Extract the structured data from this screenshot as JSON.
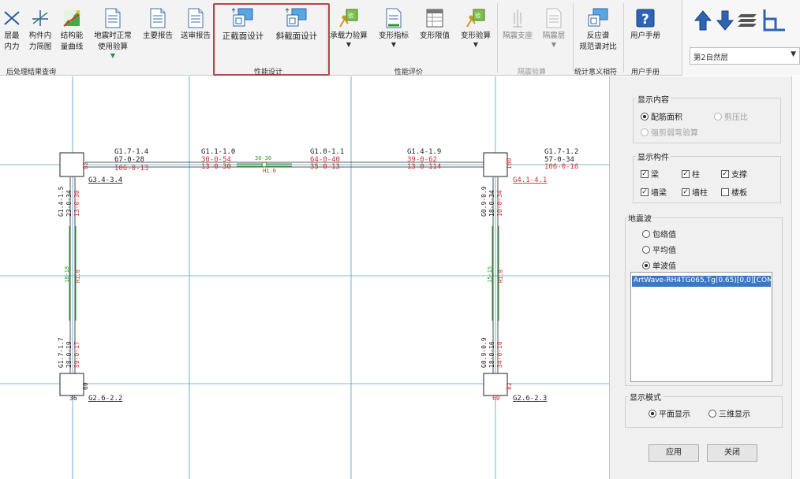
{
  "ribbon": {
    "tools": [
      {
        "id": "force",
        "line1": "层最",
        "line2": "内力",
        "icon": "force-icon"
      },
      {
        "id": "member-internal",
        "line1": "构件内",
        "line2": "力简图",
        "icon": "member-force-icon"
      },
      {
        "id": "struct-perf",
        "line1": "结构能",
        "line2": "量曲线",
        "icon": "energy-curve-icon"
      },
      {
        "id": "seismic-normal",
        "line1": "地震时正常",
        "line2": "使用验算",
        "icon": "document-icon"
      },
      {
        "id": "main-report",
        "line1": "主要报告",
        "line2": "",
        "icon": "document-icon"
      },
      {
        "id": "review-report",
        "line1": "送审报告",
        "line2": "",
        "icon": "document-icon"
      },
      {
        "id": "normal-section",
        "line1": "正截面设计",
        "line2": "",
        "icon": "section-design-icon"
      },
      {
        "id": "oblique-section",
        "line1": "斜截面设计",
        "line2": "",
        "icon": "section-design-icon"
      },
      {
        "id": "bearing-check",
        "line1": "承载力验算",
        "line2": "",
        "icon": "check-icon"
      },
      {
        "id": "deform-index",
        "line1": "变形指标",
        "line2": "",
        "icon": "document-icon"
      },
      {
        "id": "deform-limit",
        "line1": "变形限值",
        "line2": "",
        "icon": "table-icon"
      },
      {
        "id": "deform-check",
        "line1": "变形验算",
        "line2": "",
        "icon": "check-icon"
      },
      {
        "id": "isolation-support",
        "line1": "隔震支座",
        "line2": "",
        "icon": "support-icon"
      },
      {
        "id": "isolation-layer",
        "line1": "隔震层",
        "line2": "",
        "icon": "document-icon"
      },
      {
        "id": "response-spectrum",
        "line1": "反应谱",
        "line2": "规范谱对比",
        "icon": "spectrum-icon"
      },
      {
        "id": "user-manual",
        "line1": "用户手册",
        "line2": "",
        "icon": "help-icon"
      }
    ],
    "groups": {
      "postprocess": "后处理结果查询",
      "performance_design": "性能设计",
      "performance_eval": "性能评价",
      "isolation_check": "隔震验算",
      "statistics": "统计意义相符",
      "manual": "用户手册"
    },
    "floor_selector": "第2自然层"
  },
  "canvas": {
    "labels": {
      "beam1": [
        "G1.7-1.4",
        "67-0-28",
        "106-0-13"
      ],
      "beam2": [
        "G1.1-1.0",
        "30-0-54",
        "13-0-30"
      ],
      "beam3": [
        "G1.0-1.1",
        "64-0-40",
        "35-0-13"
      ],
      "beam4": [
        "G1.4-1.9",
        "39-0-62",
        "13-0-114"
      ],
      "beam5": [
        "G1.7-1.2",
        "57-0-34",
        "106-0-16"
      ],
      "coupling_top": "30-30",
      "coupling_bot": "H1.0",
      "col_tl": "G3.4-3.4",
      "col_tr": "G4.1-4.1",
      "col_bl": "G2.6-2.2",
      "col_br": "G2.6-2.3",
      "col_tl_num": "82",
      "col_tr_num": "100",
      "col_bl_num": "60",
      "col_bl_num2": "36",
      "col_br_num": "82",
      "col_br_num2": "60",
      "vbeam_l_top": [
        "G1.4-1.5",
        "23-0-34",
        "13-0-30"
      ],
      "vbeam_r_top": [
        "G0.9-0.9",
        "18-0-34",
        "10-0-34"
      ],
      "vbeam_l_bot": [
        "G1.7-1.7",
        "28-0-19",
        "59-0-17"
      ],
      "vbeam_r_bot": [
        "G0.9-0.9",
        "18-0-16",
        "34-0-10"
      ],
      "wall_l": [
        "18-18",
        "H1.0"
      ],
      "wall_r": [
        "15-15",
        "H1.0"
      ]
    }
  },
  "panel": {
    "display_content": {
      "title": "显示内容",
      "rebar_area": "配筋面积",
      "shear_ratio": "剪压比",
      "strong_shear": "强剪弱弯验算"
    },
    "display_members": {
      "title": "显示构件",
      "beam": "梁",
      "column": "柱",
      "brace": "支撑",
      "wall_beam": "墙梁",
      "wall_column": "墙柱",
      "slab": "楼板"
    },
    "seismic_wave": {
      "title": "地震波",
      "envelope": "包络值",
      "average": "平均值",
      "single": "单波值",
      "selected_wave": "ArtWave-RH4TG065,Tg(0.65)[0,0][COMB"
    },
    "display_mode": {
      "title": "显示模式",
      "plan": "平面显示",
      "three_d": "三维显示"
    },
    "apply": "应用",
    "close": "关闭"
  },
  "colors": {
    "grid": "#4aa3c8",
    "member": "#222222",
    "red_text": "#d03030",
    "green_line": "#2e9a2e",
    "highlight": "#b8454b",
    "selection": "#3a78c6"
  }
}
